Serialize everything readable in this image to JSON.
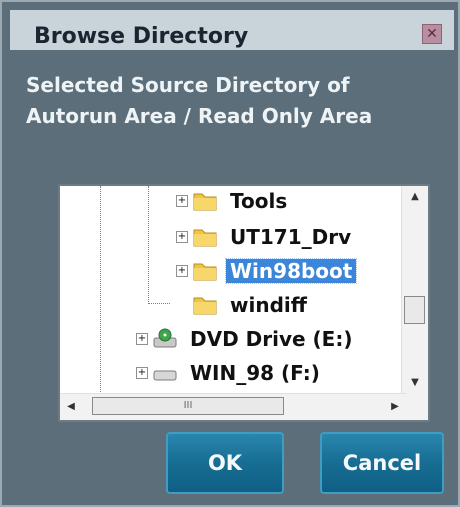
{
  "dialog": {
    "title": "Browse Directory",
    "close_icon": "close-x",
    "description": "Selected Source Directory of Autorun Area / Read Only Area"
  },
  "tree": {
    "items": [
      {
        "label": "Tools",
        "icon": "folder-icon",
        "expander": "+"
      },
      {
        "label": "UT171_Drv",
        "icon": "folder-icon",
        "expander": "+"
      },
      {
        "label": "Win98boot",
        "icon": "folder-icon",
        "expander": "+",
        "selected": true
      },
      {
        "label": "windiff",
        "icon": "folder-icon"
      },
      {
        "label": "DVD Drive (E:)",
        "icon": "dvd-drive-icon",
        "expander": "+"
      },
      {
        "label": "WIN_98 (F:)",
        "icon": "drive-icon",
        "expander": "+"
      }
    ],
    "hscroll_grip": "III"
  },
  "buttons": {
    "ok": "OK",
    "cancel": "Cancel"
  },
  "colors": {
    "dialog_bg": "#5b6e79",
    "titlebar_bg": "#c8d3da",
    "button_bg": "#176d93",
    "selection": "#3b86d8"
  }
}
